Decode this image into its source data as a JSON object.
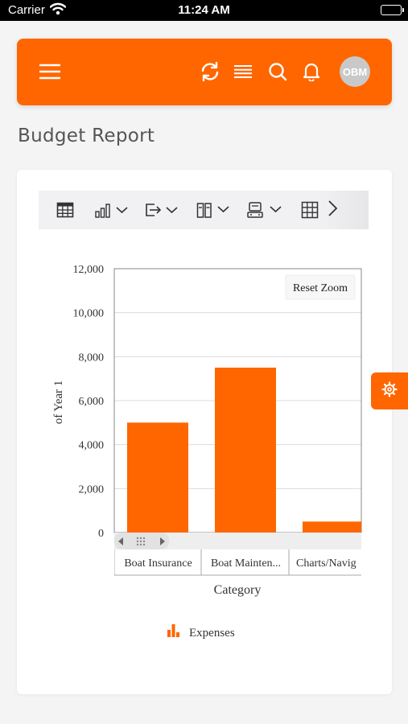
{
  "status_bar": {
    "carrier": "Carrier",
    "time": "11:24 AM"
  },
  "header": {
    "avatar_initials": "OBM",
    "accent_color": "#ff6600",
    "icons": [
      "menu-icon",
      "refresh-icon",
      "list-icon",
      "search-icon",
      "bell-icon"
    ]
  },
  "page": {
    "title": "Budget Report"
  },
  "toolbar": {
    "buttons": [
      "table-icon",
      "bar-chart-icon",
      "export-icon",
      "columns-icon",
      "layout-icon",
      "grid-icon"
    ],
    "next": "chevron-right-icon"
  },
  "chart": {
    "reset_zoom_label": "Reset Zoom",
    "series_color": "#ff6600"
  },
  "chart_data": {
    "type": "bar",
    "categories": [
      "Boat Insurance",
      "Boat Mainten...",
      "Charts/Navig"
    ],
    "series": [
      {
        "name": "Expenses",
        "values": [
          5000,
          7500,
          500
        ]
      }
    ],
    "ylabel": "of Year 1",
    "xlabel": "Category",
    "ylim": [
      0,
      12000
    ],
    "yticks": [
      "0",
      "2,000",
      "4,000",
      "6,000",
      "8,000",
      "10,000",
      "12,000"
    ],
    "grid": true,
    "legend": "bottom-center"
  }
}
